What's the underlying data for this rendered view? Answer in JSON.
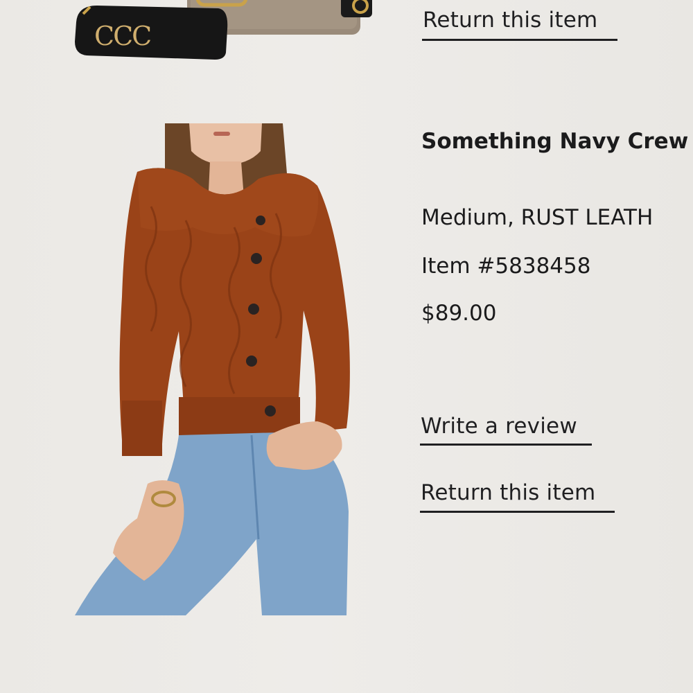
{
  "top_item": {
    "return_link": "Return this item",
    "bag_logo": "CCC"
  },
  "product": {
    "title": "Something Navy Crew",
    "variant": "Medium, RUST LEATH",
    "item_number": "Item #5838458",
    "price": "$89.00",
    "write_review_link": "Write a review",
    "return_link": "Return this item",
    "colors": {
      "sweater": "#9a4318",
      "jeans": "#7fa4c9",
      "background": "#ecebe7"
    }
  }
}
